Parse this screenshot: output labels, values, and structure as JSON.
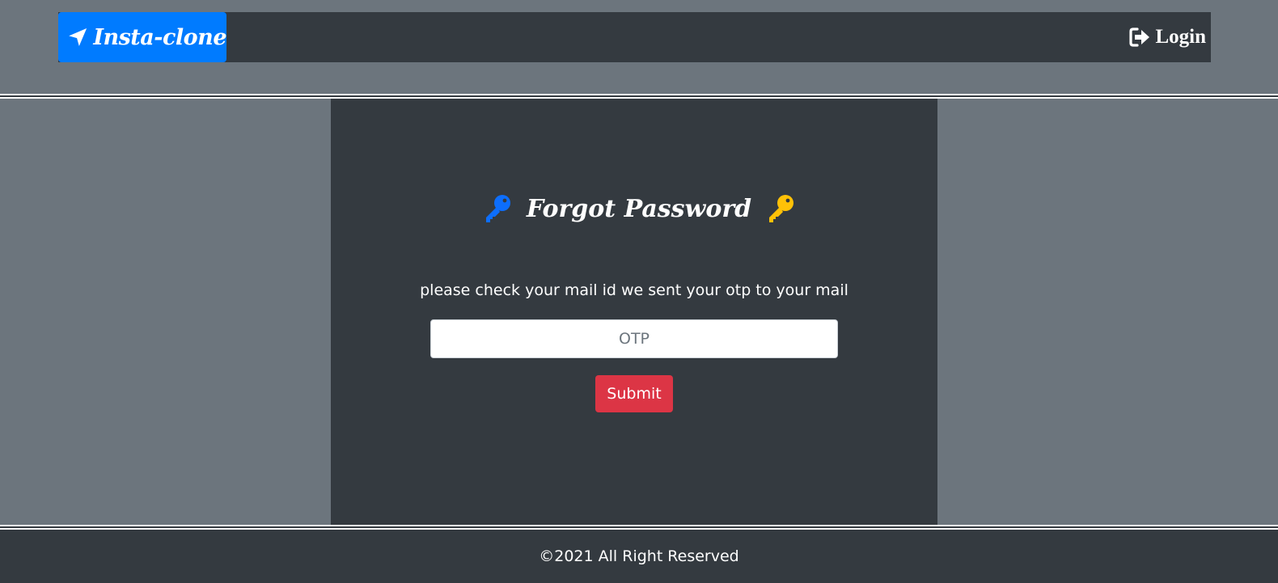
{
  "navbar": {
    "brand_label": "Insta-clone",
    "brand_icon": "paper-plane-icon",
    "login_label": "Login",
    "login_icon": "sign-in-icon"
  },
  "form": {
    "title": "Forgot Password",
    "left_icon": "key-icon",
    "right_icon": "key-icon",
    "message": "please check your mail id we sent your otp to your mail",
    "otp_placeholder": "OTP",
    "otp_value": "",
    "submit_label": "Submit"
  },
  "footer": {
    "text": "©2021 All Right Reserved"
  },
  "colors": {
    "page_background": "#6c757d",
    "dark_panel": "#343a40",
    "brand_blue": "#007bff",
    "submit_red": "#dc3545",
    "key_blue": "#0d6efd",
    "key_gold": "#ffc107"
  }
}
